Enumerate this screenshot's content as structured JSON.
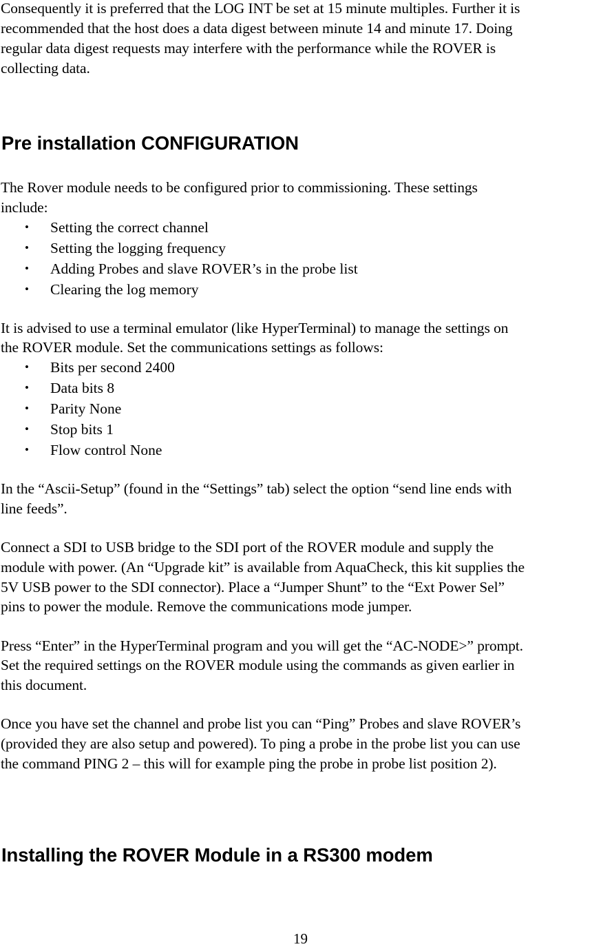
{
  "document": {
    "intro_lines": [
      "Consequently it is preferred that the LOG INT be set at 15 minute multiples. Further it is",
      "recommended that the host does a data digest between minute 14 and minute 17. Doing",
      "regular data digest requests may interfere with the performance while the ROVER is",
      "collecting data."
    ],
    "section1": {
      "heading": "Pre installation CONFIGURATION",
      "para1_lines": [
        "The Rover module needs to be configured prior to commissioning. These settings",
        "include:"
      ],
      "settings_list": [
        "Setting the correct channel",
        "Setting the logging frequency",
        "Adding Probes and slave ROVER’s in the probe list",
        "Clearing the log memory"
      ],
      "para2_lines": [
        "It is advised to use a terminal emulator (like HyperTerminal) to manage the settings on",
        "the ROVER module. Set the communications settings as follows:"
      ],
      "comm_list": [
        "Bits per second 2400",
        "Data bits 8",
        "Parity None",
        "Stop bits 1",
        "Flow control None"
      ],
      "para3_lines": [
        "In the “Ascii-Setup” (found in the “Settings” tab) select the option “send line ends with",
        "line feeds”."
      ],
      "para4_lines": [
        "Connect a SDI to USB bridge to the SDI port of the ROVER module and supply the",
        "module with power. (An “Upgrade kit” is available from AquaCheck, this kit supplies the",
        "5V USB power to the SDI connector). Place a “Jumper Shunt” to the “Ext Power Sel”",
        "pins to power the module. Remove the communications mode jumper."
      ],
      "para5_lines": [
        "Press “Enter” in the HyperTerminal program and you will get the “AC-NODE>” prompt.",
        "Set the required settings on the ROVER module using the commands as given earlier in",
        "this document."
      ],
      "para6_lines": [
        "Once you have set the channel and probe list you can “Ping” Probes and slave ROVER’s",
        "(provided they are also setup and powered). To ping a probe in the probe list you can use",
        "the command PING 2 – this will for example ping the probe in probe list position 2)."
      ]
    },
    "section2": {
      "heading": "Installing the ROVER Module in a RS300 modem"
    },
    "bullet_glyph": "•",
    "page_number": "19"
  }
}
